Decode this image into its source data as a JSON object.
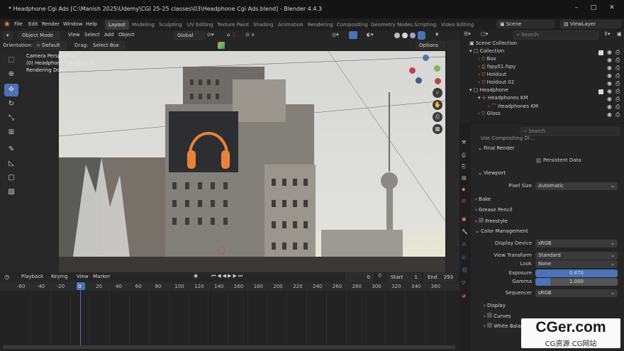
{
  "window": {
    "title": "* Headphone Cgi Ads [C:\\Manish 2025\\Udemy\\CGI 25-25 classes\\03\\Headphone Cgi Ads.blend] - Blender 4.4.3"
  },
  "menu": [
    "File",
    "Edit",
    "Render",
    "Window",
    "Help"
  ],
  "workspaces": [
    "Layout",
    "Modeling",
    "Sculpting",
    "UV Editing",
    "Texture Paint",
    "Shading",
    "Animation",
    "Rendering",
    "Compositing",
    "Geometry Nodes",
    "Scripting",
    "Video Editing"
  ],
  "scene_selector": {
    "label": "Scene"
  },
  "view_layer": {
    "label": "ViewLayer"
  },
  "header": {
    "mode": "Object Mode",
    "view": "View",
    "select": "Select",
    "add": "Add",
    "object": "Object",
    "orientation_space": "Global"
  },
  "toolbar2": {
    "orientation_label": "Orientation:",
    "orientation_value": "Default",
    "drag_label": "Drag:",
    "drag_value": "Select Box",
    "options": "Options"
  },
  "viewport": {
    "line1": "Camera Perspective",
    "line2": "(0) Headphone | Holdout 02",
    "line3": "Rendering Done"
  },
  "timeline": {
    "playback": "Playback",
    "keying": "Keying",
    "view": "View",
    "marker": "Marker",
    "current_frame": "0",
    "start_label": "Start",
    "start": "1",
    "end_label": "End",
    "end": "293",
    "ticks": [
      "-60",
      "-40",
      "-20",
      "0",
      "20",
      "40",
      "60",
      "80",
      "100",
      "120",
      "140",
      "160",
      "180",
      "200",
      "220",
      "240",
      "260",
      "280",
      "300",
      "320",
      "340",
      "360"
    ]
  },
  "outliner": {
    "search_placeholder": "Search",
    "rows": [
      {
        "label": "Scene Collection",
        "indent": 0
      },
      {
        "label": "Collection",
        "indent": 1
      },
      {
        "label": "Box",
        "indent": 2
      },
      {
        "label": "fspy01.fspy",
        "indent": 2
      },
      {
        "label": "Holdout",
        "indent": 2
      },
      {
        "label": "Holdout 02",
        "indent": 2
      },
      {
        "label": "Headphone",
        "indent": 1
      },
      {
        "label": "Headphones KM",
        "indent": 2
      },
      {
        "label": "Headphones KM",
        "indent": 3
      },
      {
        "label": "Glass",
        "indent": 2
      }
    ]
  },
  "properties": {
    "search_placeholder": "Search",
    "top_cut": "Use Compositing Dl...",
    "final_render": "Final Render",
    "persistent_data": "Persistent Data",
    "viewport": "Viewport",
    "pixel_size_label": "Pixel Size",
    "pixel_size": "Automatic",
    "bake": "Bake",
    "grease_pencil": "Grease Pencil",
    "freestyle": "Freestyle",
    "color_management": "Color Management",
    "display_device_label": "Display Device",
    "display_device": "sRGB",
    "view_transform_label": "View Transform",
    "view_transform": "Standard",
    "look_label": "Look",
    "look": "None",
    "exposure_label": "Exposure",
    "exposure": "0.870",
    "gamma_label": "Gamma",
    "gamma": "1.000",
    "sequencer_label": "Sequencer",
    "sequencer": "sRGB",
    "display": "Display",
    "curves": "Curves",
    "white_balance": "White Balance"
  },
  "watermark": {
    "big": "CGer.com",
    "small": "CG资源 CG网站"
  },
  "colors": {
    "accent": "#4a73b8",
    "orange": "#e8823a",
    "green": "#6fc060"
  }
}
